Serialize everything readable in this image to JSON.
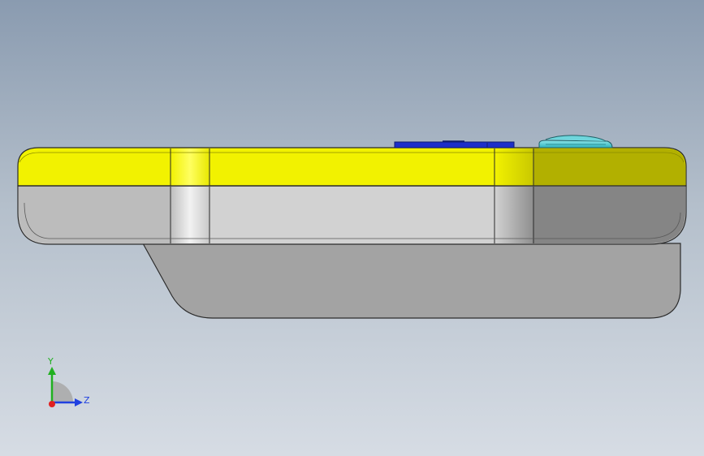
{
  "colors": {
    "background_top": "#8a9bb0",
    "background_bottom": "#d6dce4",
    "top_shell": "#f2f200",
    "top_shell_shadow": "#b2b000",
    "mid_shell": "#d2d2d2",
    "mid_shell_left": "#bcbcbc",
    "mid_shell_shadow": "#858585",
    "bottom_shell": "#a3a3a3",
    "blue_button": "#1d2fc8",
    "cyan_button": "#46c7cf",
    "outline": "#2b2b2b",
    "axis_x": "#e02020",
    "axis_y": "#20b020",
    "axis_z": "#2040e0"
  },
  "triad": {
    "y_label": "Y",
    "z_label": "Z"
  }
}
